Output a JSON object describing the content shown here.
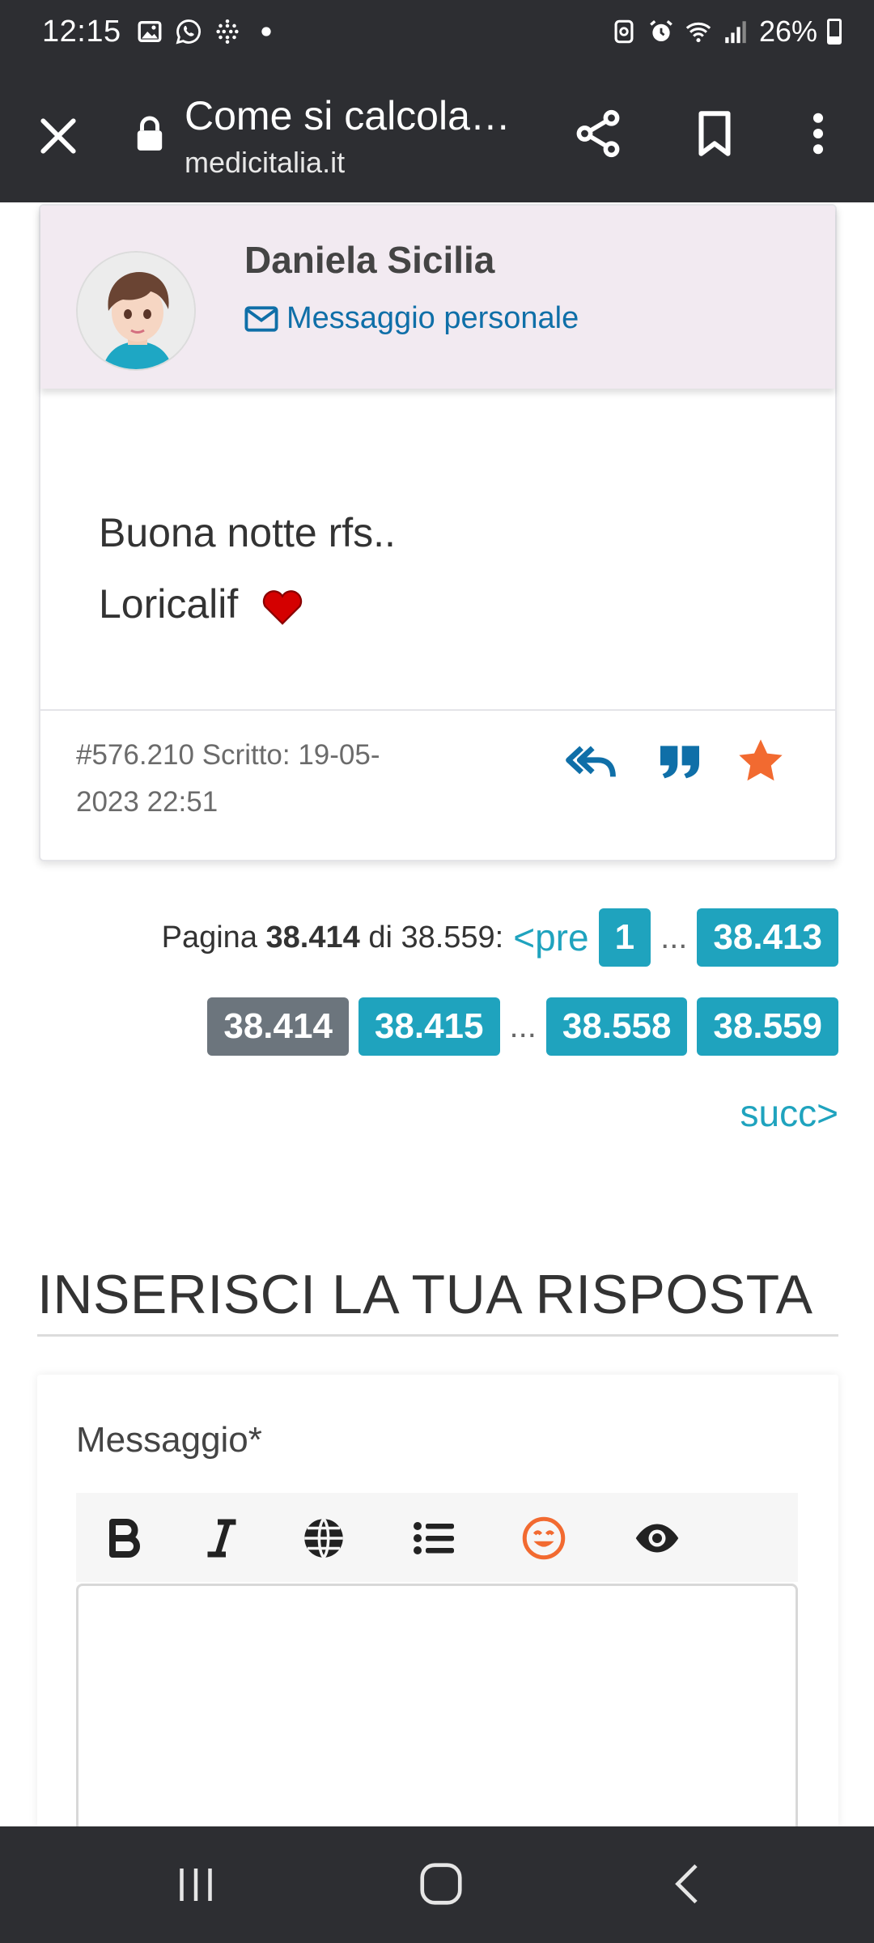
{
  "status_bar": {
    "time": "12:15",
    "battery": "26%",
    "icons": [
      "gallery-icon",
      "whatsapp-icon",
      "dots-grid-icon",
      "dot-icon",
      "battery-saver-icon",
      "alarm-icon",
      "wifi-icon",
      "signal-icon",
      "battery-icon"
    ]
  },
  "browser": {
    "title": "Come si calcola…",
    "url": "medicitalia.it"
  },
  "post": {
    "author": "Daniela Sicilia",
    "pm_label": "Messaggio personale",
    "body_line1": "Buona notte rfs..",
    "body_line2": "Loricalif",
    "meta": "#576.210 Scritto: 19-05-2023 22:51"
  },
  "pagination": {
    "label": "Pagina",
    "current_bold": "38.414",
    "of_text": "di 38.559:",
    "prev": "<pre",
    "first": "1",
    "ellipsis": "...",
    "p_prev": "38.413",
    "p_current": "38.414",
    "p_next": "38.415",
    "p_second_last": "38.558",
    "p_last": "38.559",
    "next": "succ>"
  },
  "reply": {
    "title": "INSERISCI LA TUA RISPOSTA",
    "message_label": "Messaggio*"
  },
  "colors": {
    "dark_bar": "#2d2e32",
    "link_blue": "#0f6fa8",
    "teal": "#1fa3be",
    "page_current": "#6c757d",
    "star_orange": "#f26a30",
    "card_head": "#f2eaf1"
  }
}
